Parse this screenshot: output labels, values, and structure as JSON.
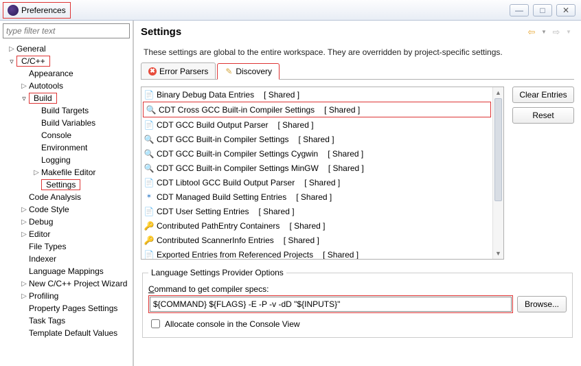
{
  "window": {
    "title": "Preferences"
  },
  "sidebar": {
    "filter_placeholder": "type filter text",
    "items": [
      {
        "label": "General",
        "depth": 0,
        "exp": "right"
      },
      {
        "label": "C/C++",
        "depth": 0,
        "exp": "down",
        "hl": true
      },
      {
        "label": "Appearance",
        "depth": 1,
        "exp": "none"
      },
      {
        "label": "Autotools",
        "depth": 1,
        "exp": "right"
      },
      {
        "label": "Build",
        "depth": 1,
        "exp": "down",
        "hl": true
      },
      {
        "label": "Build Targets",
        "depth": 2,
        "exp": "none"
      },
      {
        "label": "Build Variables",
        "depth": 2,
        "exp": "none"
      },
      {
        "label": "Console",
        "depth": 2,
        "exp": "none"
      },
      {
        "label": "Environment",
        "depth": 2,
        "exp": "none"
      },
      {
        "label": "Logging",
        "depth": 2,
        "exp": "none"
      },
      {
        "label": "Makefile Editor",
        "depth": 2,
        "exp": "right"
      },
      {
        "label": "Settings",
        "depth": 2,
        "exp": "none",
        "hl": true
      },
      {
        "label": "Code Analysis",
        "depth": 1,
        "exp": "none"
      },
      {
        "label": "Code Style",
        "depth": 1,
        "exp": "right"
      },
      {
        "label": "Debug",
        "depth": 1,
        "exp": "right"
      },
      {
        "label": "Editor",
        "depth": 1,
        "exp": "right"
      },
      {
        "label": "File Types",
        "depth": 1,
        "exp": "none"
      },
      {
        "label": "Indexer",
        "depth": 1,
        "exp": "none"
      },
      {
        "label": "Language Mappings",
        "depth": 1,
        "exp": "none"
      },
      {
        "label": "New C/C++ Project Wizard",
        "depth": 1,
        "exp": "right"
      },
      {
        "label": "Profiling",
        "depth": 1,
        "exp": "right"
      },
      {
        "label": "Property Pages Settings",
        "depth": 1,
        "exp": "none"
      },
      {
        "label": "Task Tags",
        "depth": 1,
        "exp": "none"
      },
      {
        "label": "Template Default Values",
        "depth": 1,
        "exp": "none"
      }
    ]
  },
  "main": {
    "title": "Settings",
    "description": "These settings are global to the entire workspace.  They are overridden by project-specific settings.",
    "tabs": {
      "error_parsers": "Error Parsers",
      "discovery": "Discovery"
    },
    "buttons": {
      "clear": "Clear Entries",
      "reset": "Reset",
      "browse": "Browse..."
    },
    "list": [
      {
        "icon": "doc",
        "label": "Binary Debug Data Entries",
        "shared": "[ Shared ]"
      },
      {
        "icon": "mag",
        "label": "CDT Cross GCC Built-in Compiler Settings",
        "shared": "[ Shared ]",
        "sel": true
      },
      {
        "icon": "doc",
        "label": "CDT GCC Build Output Parser",
        "shared": "[ Shared ]"
      },
      {
        "icon": "mag",
        "label": "CDT GCC Built-in Compiler Settings",
        "shared": "[ Shared ]"
      },
      {
        "icon": "mag",
        "label": "CDT GCC Built-in Compiler Settings Cygwin",
        "shared": "[ Shared ]"
      },
      {
        "icon": "mag",
        "label": "CDT GCC Built-in Compiler Settings MinGW",
        "shared": "[ Shared ]"
      },
      {
        "icon": "doc",
        "label": "CDT Libtool GCC Build Output Parser",
        "shared": "[ Shared ]"
      },
      {
        "icon": "star",
        "label": "CDT Managed Build Setting Entries",
        "shared": "[ Shared ]"
      },
      {
        "icon": "doc",
        "label": "CDT User Setting Entries",
        "shared": "[ Shared ]"
      },
      {
        "icon": "key",
        "label": "Contributed PathEntry Containers",
        "shared": "[ Shared ]"
      },
      {
        "icon": "key",
        "label": "Contributed ScannerInfo Entries",
        "shared": "[ Shared ]"
      },
      {
        "icon": "doc",
        "label": "Exported Entries from Referenced Projects",
        "shared": "[ Shared ]"
      }
    ],
    "fieldset": {
      "legend": "Language Settings Provider Options",
      "cmd_label": "Command to get compiler specs:",
      "cmd_value": "${COMMAND} ${FLAGS} -E -P -v -dD \"${INPUTS}\"",
      "allocate": "Allocate console in the Console View"
    }
  }
}
